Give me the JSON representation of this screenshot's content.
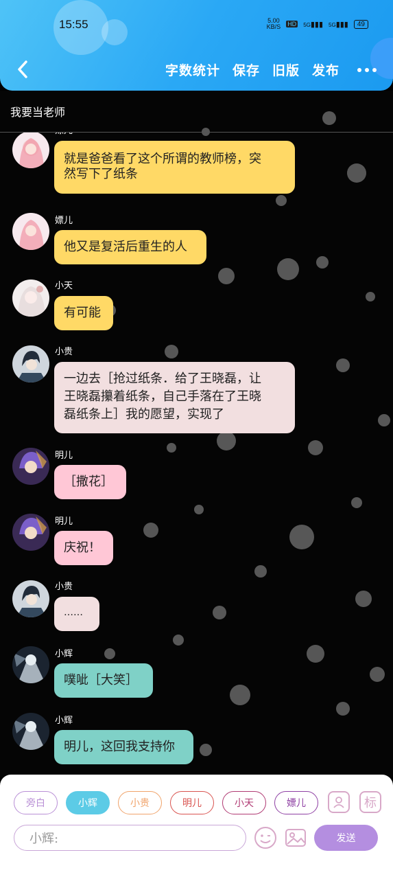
{
  "status_bar": {
    "time": "15:55",
    "net_speed": "5.00\nKB/S",
    "hd": "HD",
    "sig1": "5G",
    "sig2": "5G",
    "battery": "49"
  },
  "nav": {
    "word_count": "字数统计",
    "save": "保存",
    "old_version": "旧版",
    "publish": "发布"
  },
  "title": "我要当老师",
  "messages": [
    {
      "name": "嫖儿",
      "text_lines": [
        "就是爸爸看了这个所谓的教师榜，突",
        "然写下了纸条"
      ],
      "color": "yellow",
      "avatar": "pink-hair-girl"
    },
    {
      "name": "嫖儿",
      "text_lines": [
        "他又是复活后重生的人"
      ],
      "color": "yellow",
      "avatar": "pink-hair-girl"
    },
    {
      "name": "小天",
      "text_lines": [
        "有可能"
      ],
      "color": "yellow",
      "avatar": "white-hair-girl"
    },
    {
      "name": "小贵",
      "text_lines": [
        "一边去［抢过纸条．给了王晓磊，让",
        "王晓磊攥着纸条，自己手落在了王晓",
        "磊纸条上］我的愿望，实现了"
      ],
      "color": "pinkgray",
      "avatar": "dark-hair-boy"
    },
    {
      "name": "明儿",
      "text_lines": [
        "［撒花］"
      ],
      "color": "pink",
      "avatar": "purple-hair-boy"
    },
    {
      "name": "明儿",
      "text_lines": [
        "庆祝！"
      ],
      "color": "pink",
      "avatar": "purple-hair-boy"
    },
    {
      "name": "小贵",
      "text_lines": [
        "……"
      ],
      "color": "pinkgray",
      "avatar": "dark-hair-boy"
    },
    {
      "name": "小辉",
      "text_lines": [
        "噗呲［大笑］"
      ],
      "color": "teal",
      "avatar": "ice-boy"
    },
    {
      "name": "小辉",
      "text_lines": [
        "明儿，这回我支持你"
      ],
      "color": "teal",
      "avatar": "ice-boy"
    }
  ],
  "role_chips": [
    {
      "label": "旁白",
      "color": "#b98fd6",
      "selected": false
    },
    {
      "label": "小辉",
      "color": "#5ccbe6",
      "selected": true
    },
    {
      "label": "小贵",
      "color": "#f0a36a",
      "selected": false
    },
    {
      "label": "明儿",
      "color": "#d9534f",
      "selected": false
    },
    {
      "label": "小天",
      "color": "#b03a73",
      "selected": false
    },
    {
      "label": "嫖儿",
      "color": "#8e3fa3",
      "selected": false
    }
  ],
  "input": {
    "placeholder": "小辉:"
  },
  "send_label": "发送",
  "colors": {
    "header": "#2aa8f5",
    "yellow": "#ffd966",
    "pinkgray": "#f2dfe0",
    "pink": "#ffc7d6",
    "teal": "#7fd1c7",
    "send": "#b48ee0"
  },
  "icons": [
    "back-arrow-icon",
    "more-icon",
    "contact-icon",
    "label-icon",
    "emoji-icon",
    "image-icon"
  ]
}
